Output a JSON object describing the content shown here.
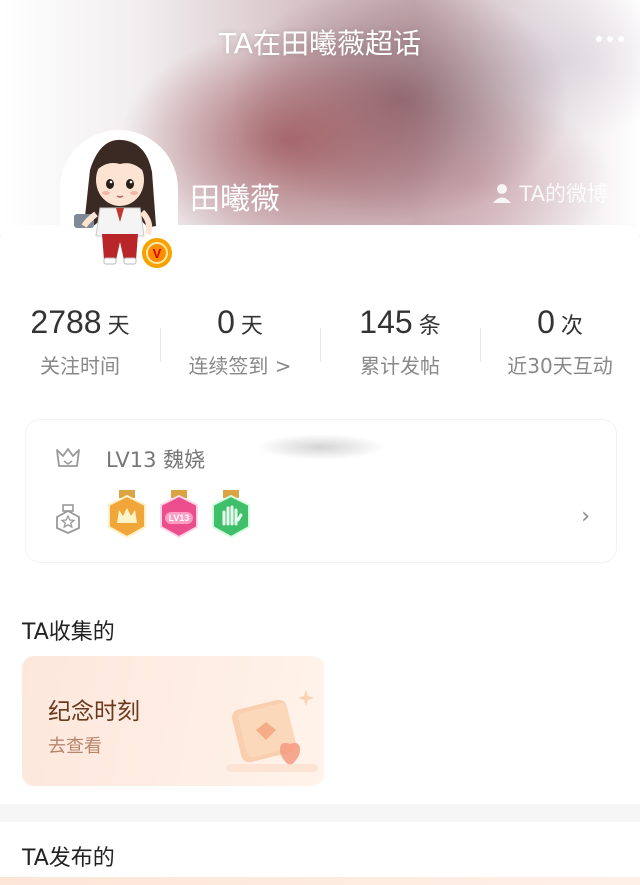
{
  "header": {
    "title": "TA在田曦薇超话"
  },
  "profile": {
    "name": "田曦薇",
    "ta_weibo": "TA的微博",
    "verified_mark": "V"
  },
  "stats": [
    {
      "value": "2788",
      "unit": "天",
      "label": "关注时间"
    },
    {
      "value": "0",
      "unit": "天",
      "label": "连续签到 >"
    },
    {
      "value": "145",
      "unit": "条",
      "label": "累计发帖"
    },
    {
      "value": "0",
      "unit": "次",
      "label": "近30天互动"
    }
  ],
  "level": {
    "text": "LV13 魏娆",
    "badges": [
      "crown-badge",
      "lv-badge",
      "hand-badge"
    ],
    "badge_lv_text": "LV13"
  },
  "collected": {
    "title": "TA收集的",
    "card_title": "纪念时刻",
    "card_sub": "去查看"
  },
  "posted": {
    "title": "TA发布的"
  },
  "colors": {
    "accent": "#ff8f00",
    "card_bg": "#fde7dc"
  }
}
